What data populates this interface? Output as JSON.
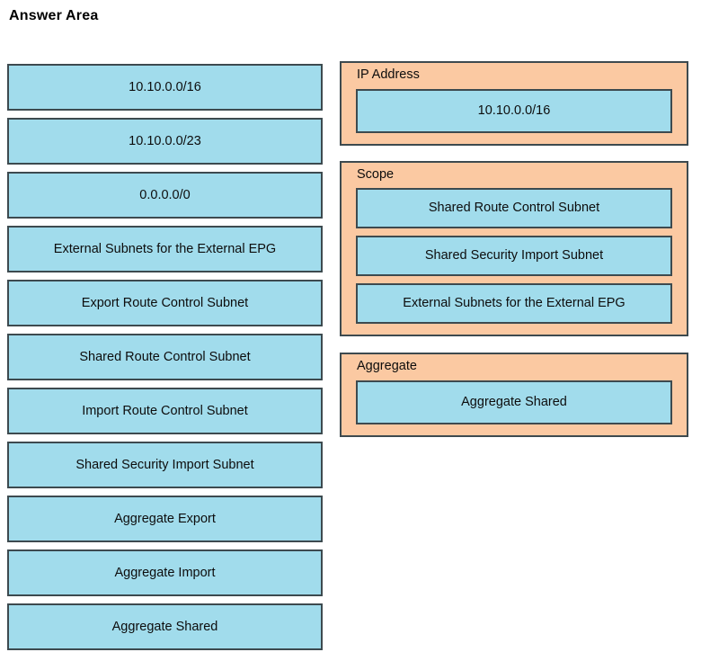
{
  "page": {
    "title": "Answer Area"
  },
  "colors": {
    "tile_fill": "#a1dcec",
    "panel_fill": "#fbc9a2",
    "border": "#3d4a4f",
    "text": "#0d0d0d",
    "background": "#ffffff"
  },
  "source_column": {
    "name": "draggable-options",
    "tiles": [
      {
        "label": "10.10.0.0/16"
      },
      {
        "label": "10.10.0.0/23"
      },
      {
        "label": "0.0.0.0/0"
      },
      {
        "label": "External Subnets for the External EPG"
      },
      {
        "label": "Export Route Control Subnet"
      },
      {
        "label": "Shared Route Control Subnet"
      },
      {
        "label": "Import Route Control Subnet"
      },
      {
        "label": "Shared Security Import Subnet"
      },
      {
        "label": "Aggregate Export"
      },
      {
        "label": "Aggregate Import"
      },
      {
        "label": "Aggregate Shared"
      }
    ]
  },
  "target_column": {
    "panels": [
      {
        "label": "IP Address",
        "tiles": [
          {
            "label": "10.10.0.0/16"
          }
        ]
      },
      {
        "label": "Scope",
        "tiles": [
          {
            "label": "Shared Route Control Subnet"
          },
          {
            "label": "Shared Security Import Subnet"
          },
          {
            "label": "External Subnets for the External EPG"
          }
        ]
      },
      {
        "label": "Aggregate",
        "tiles": [
          {
            "label": "Aggregate Shared"
          }
        ]
      }
    ]
  }
}
